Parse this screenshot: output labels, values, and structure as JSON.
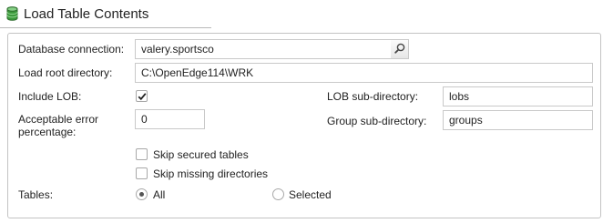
{
  "header": {
    "title": "Load Table Contents",
    "icon": "database-icon"
  },
  "form": {
    "database_connection": {
      "label": "Database connection:",
      "value": "valery.sportsco",
      "lookup_icon": "search-icon"
    },
    "load_root_directory": {
      "label": "Load root directory:",
      "value": "C:\\OpenEdge114\\WRK"
    },
    "include_lob": {
      "label": "Include LOB:",
      "checked": true
    },
    "lob_subdirectory": {
      "label": "LOB sub-directory:",
      "value": "lobs"
    },
    "acceptable_error": {
      "label": "Acceptable error percentage:",
      "value": "0"
    },
    "group_subdirectory": {
      "label": "Group sub-directory:",
      "value": "groups"
    },
    "skip_secured_tables": {
      "label": "Skip secured tables",
      "checked": false
    },
    "skip_missing_directories": {
      "label": "Skip missing directories",
      "checked": false
    },
    "tables": {
      "label": "Tables:",
      "options": [
        "All",
        "Selected"
      ],
      "selected": "All"
    }
  },
  "colors": {
    "border": "#c3c3c3",
    "icon_green": "#3c9a3c"
  }
}
